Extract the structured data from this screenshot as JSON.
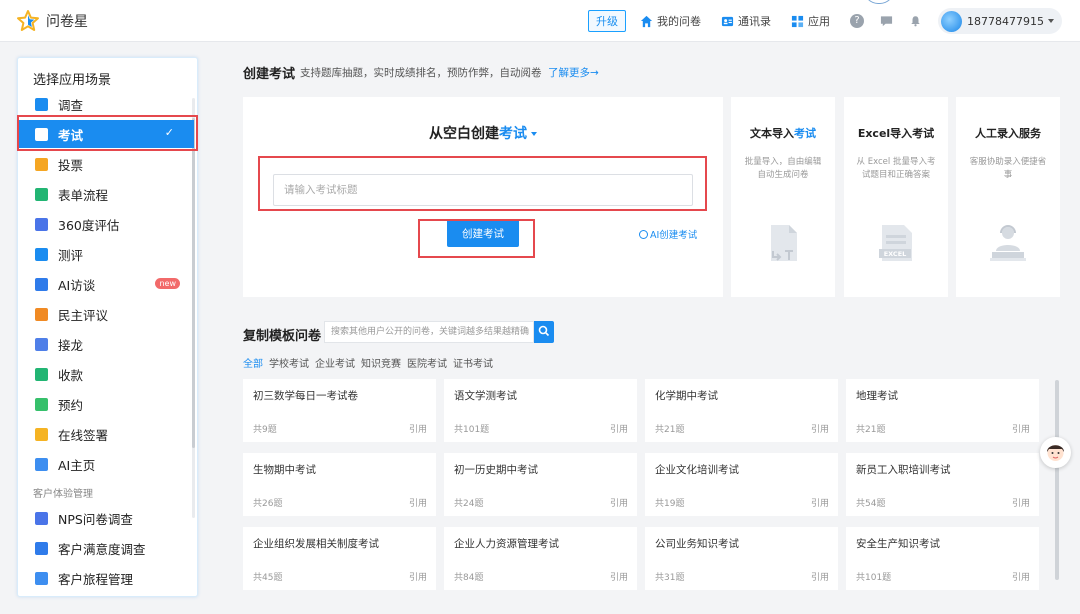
{
  "app": {
    "name": "问卷星"
  },
  "topbar": {
    "upgrade": "升级",
    "my_surveys": "我的问卷",
    "contacts": "通讯录",
    "apps": "应用",
    "help": "?",
    "username": "18778477915"
  },
  "sidebar": {
    "title": "选择应用场景",
    "items": [
      {
        "label": "调查",
        "color": "#1a8cf0"
      },
      {
        "label": "考试",
        "color": "#ffffff",
        "active": true
      },
      {
        "label": "投票",
        "color": "#f5a623"
      },
      {
        "label": "表单流程",
        "color": "#22b573"
      },
      {
        "label": "360度评估",
        "color": "#4a74e8"
      },
      {
        "label": "测评",
        "color": "#1a8cf0"
      },
      {
        "label": "AI访谈",
        "color": "#2f7bea",
        "badge": "new"
      },
      {
        "label": "民主评议",
        "color": "#f08a24"
      },
      {
        "label": "接龙",
        "color": "#4f7fe8"
      },
      {
        "label": "收款",
        "color": "#22b573"
      },
      {
        "label": "预约",
        "color": "#36c06b"
      },
      {
        "label": "在线签署",
        "color": "#f5b323"
      },
      {
        "label": "AI主页",
        "color": "#3d8ef0"
      }
    ],
    "section_cx": "客户体验管理",
    "cx_items": [
      {
        "label": "NPS问卷调查",
        "color": "#4a74e8"
      },
      {
        "label": "客户满意度调查",
        "color": "#2f7bea"
      },
      {
        "label": "客户旅程管理",
        "color": "#3d8ef0"
      }
    ]
  },
  "create": {
    "title": "创建考试",
    "desc": "支持题库抽题，实时成绩排名，预防作弊，自动阅卷",
    "learn_more": "了解更多→",
    "card_title_prefix": "从空白创建",
    "card_title_type": "考试",
    "input_placeholder": "请输入考试标题",
    "button": "创建考试",
    "ai_link": "AI创建考试"
  },
  "import_options": [
    {
      "title_prefix": "文本导入",
      "title_suffix": "考试",
      "desc": "批量导入，自由编辑自动生成问卷",
      "icon": "text-import-icon"
    },
    {
      "title_prefix": "Excel导入考试",
      "title_suffix": "",
      "desc": "从 Excel 批量导入考试题目和正确答案",
      "icon": "excel-icon"
    },
    {
      "title_prefix": "人工录入服务",
      "title_suffix": "",
      "desc": "客服协助录入便捷省事",
      "icon": "service-icon"
    }
  ],
  "templates": {
    "title": "复制模板问卷",
    "search_placeholder": "搜索其他用户公开的问卷，关键词越多结果越精确",
    "categories": [
      "全部",
      "学校考试",
      "企业考试",
      "知识竞赛",
      "医院考试",
      "证书考试"
    ],
    "use_label": "引用",
    "items": [
      {
        "name": "初三数学每日一考试卷",
        "count": "共9题"
      },
      {
        "name": "语文学测考试",
        "count": "共101题"
      },
      {
        "name": "化学期中考试",
        "count": "共21题"
      },
      {
        "name": "地理考试",
        "count": "共21题"
      },
      {
        "name": "生物期中考试",
        "count": "共26题"
      },
      {
        "name": "初一历史期中考试",
        "count": "共24题"
      },
      {
        "name": "企业文化培训考试",
        "count": "共19题"
      },
      {
        "name": "新员工入职培训考试",
        "count": "共54题"
      },
      {
        "name": "企业组织发展相关制度考试",
        "count": "共45题"
      },
      {
        "name": "企业人力资源管理考试",
        "count": "共84题"
      },
      {
        "name": "公司业务知识考试",
        "count": "共31题"
      },
      {
        "name": "安全生产知识考试",
        "count": "共101题"
      }
    ]
  }
}
